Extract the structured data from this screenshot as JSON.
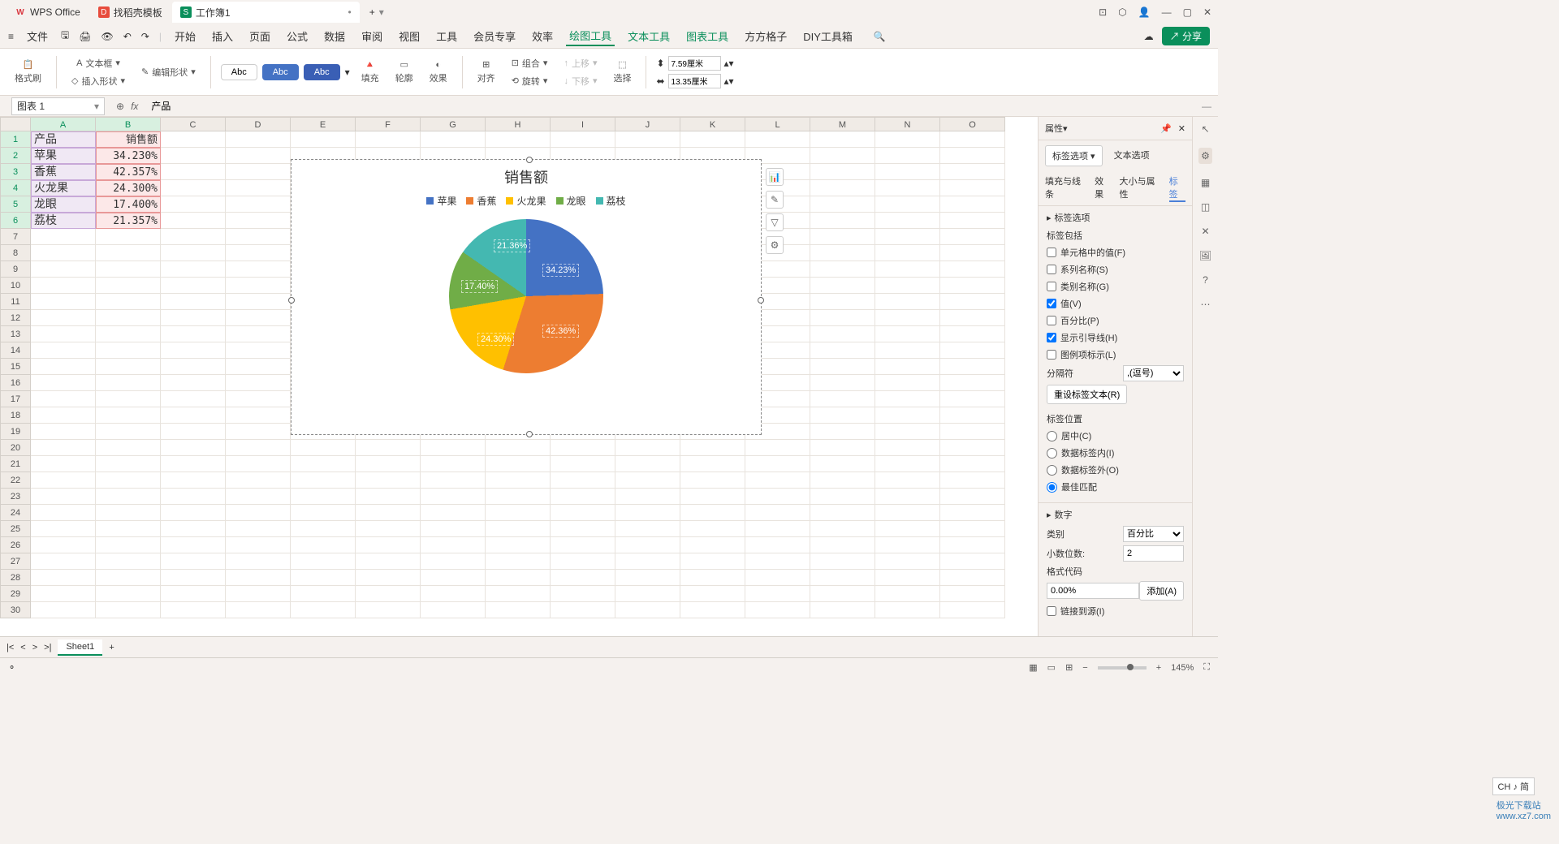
{
  "titlebar": {
    "app_tab": "WPS Office",
    "template_tab": "找稻壳模板",
    "doc_tab": "工作簿1",
    "add_tab": "+"
  },
  "menubar": {
    "file": "文件",
    "items": [
      "开始",
      "插入",
      "页面",
      "公式",
      "数据",
      "审阅",
      "视图",
      "工具",
      "会员专享",
      "效率",
      "绘图工具",
      "文本工具",
      "图表工具",
      "方方格子",
      "DIY工具箱"
    ],
    "active_index": 10,
    "share": "分享"
  },
  "ribbon": {
    "format_painter": "格式刷",
    "insert_shape": "插入形状",
    "text_box": "文本框",
    "edit_shape": "编辑形状",
    "style_abc": "Abc",
    "fill": "填充",
    "outline": "轮廓",
    "effect": "效果",
    "align": "对齐",
    "group": "组合",
    "rotate": "旋转",
    "move_up": "上移",
    "move_down": "下移",
    "select": "选择",
    "width": "7.59厘米",
    "height": "13.35厘米"
  },
  "formula": {
    "name_box": "图表 1",
    "fx_label": "fx",
    "value": "产品"
  },
  "columns": [
    "A",
    "B",
    "C",
    "D",
    "E",
    "F",
    "G",
    "H",
    "I",
    "J",
    "K",
    "L",
    "M",
    "N",
    "O"
  ],
  "row_count": 30,
  "table": {
    "header_a": "产品",
    "header_b": "销售额",
    "rows": [
      {
        "a": "苹果",
        "b": "34.230%"
      },
      {
        "a": "香蕉",
        "b": "42.357%"
      },
      {
        "a": "火龙果",
        "b": "24.300%"
      },
      {
        "a": "龙眼",
        "b": "17.400%"
      },
      {
        "a": "荔枝",
        "b": "21.357%"
      }
    ]
  },
  "chart_data": {
    "type": "pie",
    "title": "销售额",
    "categories": [
      "苹果",
      "香蕉",
      "火龙果",
      "龙眼",
      "荔枝"
    ],
    "values": [
      34.23,
      42.36,
      24.3,
      17.4,
      21.36
    ],
    "labels": [
      "34.23%",
      "42.36%",
      "24.30%",
      "17.40%",
      "21.36%"
    ],
    "colors": [
      "#4472c4",
      "#ed7d31",
      "#ffc000",
      "#70ad47",
      "#44b8b1"
    ]
  },
  "panel": {
    "title": "属性",
    "tab_label_options": "标签选项",
    "tab_text_options": "文本选项",
    "subtabs": [
      "填充与线条",
      "效果",
      "大小与属性",
      "标签"
    ],
    "section_label_options": "标签选项",
    "label_contains": "标签包括",
    "chk_cell_value": "单元格中的值(F)",
    "chk_series_name": "系列名称(S)",
    "chk_category_name": "类别名称(G)",
    "chk_value": "值(V)",
    "chk_percentage": "百分比(P)",
    "chk_leader_lines": "显示引导线(H)",
    "chk_legend_key": "图例项标示(L)",
    "separator_label": "分隔符",
    "separator_value": ",(逗号)",
    "reset_label_text": "重设标签文本(R)",
    "label_position": "标签位置",
    "pos_center": "居中(C)",
    "pos_inside": "数据标签内(I)",
    "pos_outside": "数据标签外(O)",
    "pos_best": "最佳匹配",
    "section_number": "数字",
    "category_label": "类别",
    "category_value": "百分比",
    "decimals_label": "小数位数:",
    "decimals_value": "2",
    "format_code_label": "格式代码",
    "format_code_value": "0.00%",
    "add_btn": "添加(A)",
    "link_source": "链接到源(I)"
  },
  "sheet_tabs": {
    "sheet1": "Sheet1"
  },
  "statusbar": {
    "zoom": "145%"
  },
  "ime": "CH ♪ 简",
  "watermark": {
    "line1": "极光下载站",
    "line2": "www.xz7.com"
  }
}
